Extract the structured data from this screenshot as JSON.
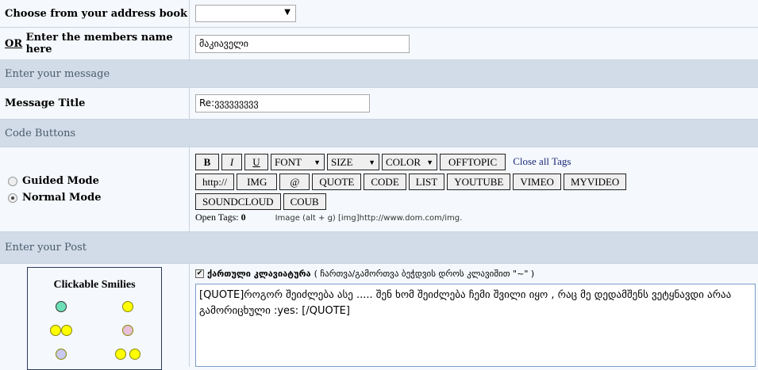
{
  "recipient": {
    "address_book_label": "Choose from your address book",
    "address_book_value": "",
    "or_label": "OR",
    "name_label": "Enter the members name here",
    "name_value": "მაკიაველი"
  },
  "message": {
    "header": "Enter your message",
    "title_label": "Message Title",
    "title_value": "Re:ვვვვვვვვვ"
  },
  "code": {
    "header": "Code Buttons",
    "guided": "Guided Mode",
    "normal": "Normal Mode",
    "selected_mode": "normal",
    "row1": {
      "bold": "B",
      "italic": "I",
      "underline": "U",
      "font": "FONT",
      "size": "SIZE",
      "color": "COLOR",
      "offtopic": "OFFTOPIC",
      "close_all": "Close all Tags"
    },
    "row2": [
      "http://",
      "IMG",
      "@",
      "QUOTE",
      "CODE",
      "LIST",
      "YOUTUBE",
      "VIMEO",
      "MYVIDEO"
    ],
    "row3": [
      "SOUNDCLOUD",
      "COUB"
    ],
    "open_tags_label": "Open Tags:",
    "open_tags_count": "0",
    "hint": "Image (alt + g) [img]http://www.dom.com/img."
  },
  "post": {
    "header": "Enter your Post",
    "smilies_title": "Clickable Smilies",
    "keyboard_label": "ქართული კლავიატურა",
    "keyboard_note": "( ჩართვა/გამორთვა ბეჭდვის დროს კლავიშით \"~\" )",
    "keyboard_checked": true,
    "body": "[QUOTE]როგორ შეიძლება ასე ..... შენ ხომ შეიძლება ჩემი შვილი იყო , რაც მე დედამშენს ვეტყნავდი არაა გამორიცხული :yes: [/QUOTE]"
  }
}
